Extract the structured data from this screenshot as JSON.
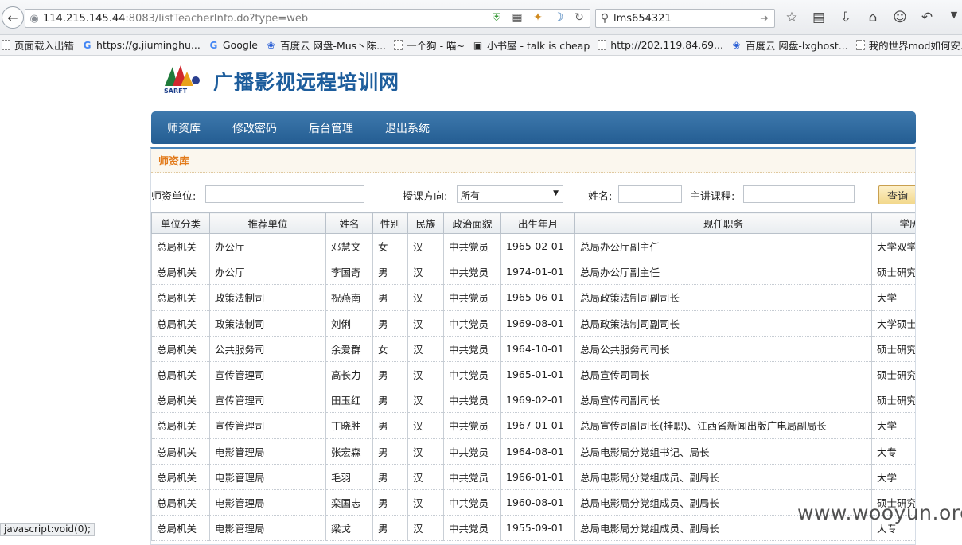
{
  "browser": {
    "url_host": "114.215.145.44",
    "url_rest": ":8083/listTeacherInfo.do?type=web",
    "search_text": "lms654321",
    "bookmarks": [
      {
        "label": "页面载入出错",
        "icon": "page"
      },
      {
        "label": "https://g.jiuminghu...",
        "icon": "google-g"
      },
      {
        "label": "Google",
        "icon": "google-g"
      },
      {
        "label": "百度云 网盘-Mus丶陈...",
        "icon": "baidu-paw"
      },
      {
        "label": "一个狗 - 喵~",
        "icon": "page"
      },
      {
        "label": "小书屋 - talk is cheap",
        "icon": "book"
      },
      {
        "label": "http://202.119.84.69...",
        "icon": "page"
      },
      {
        "label": "百度云 网盘-lxghost...",
        "icon": "baidu-paw"
      },
      {
        "label": "我的世界mod如何安...",
        "icon": "page"
      }
    ]
  },
  "site": {
    "logo_text": "SARFT",
    "title": "广播影视远程培训网",
    "nav": [
      "师资库",
      "修改密码",
      "后台管理",
      "退出系统"
    ]
  },
  "panel": {
    "heading": "师资库",
    "filters": {
      "unit_label": "师资单位:",
      "direction_label": "授课方向:",
      "direction_value": "所有",
      "name_label": "姓名:",
      "course_label": "主讲课程:",
      "query_button": "查询"
    }
  },
  "table": {
    "columns": [
      "单位分类",
      "推荐单位",
      "姓名",
      "性别",
      "民族",
      "政治面貌",
      "出生年月",
      "现任职务",
      "学历"
    ],
    "rows": [
      [
        "总局机关",
        "办公厅",
        "邓慧文",
        "女",
        "汉",
        "中共党员",
        "1965-02-01",
        "总局办公厅副主任",
        "大学双学位"
      ],
      [
        "总局机关",
        "办公厅",
        "李国奇",
        "男",
        "汉",
        "中共党员",
        "1974-01-01",
        "总局办公厅副主任",
        "硕士研究生"
      ],
      [
        "总局机关",
        "政策法制司",
        "祝燕南",
        "男",
        "汉",
        "中共党员",
        "1965-06-01",
        "总局政策法制司副司长",
        "大学"
      ],
      [
        "总局机关",
        "政策法制司",
        "刘俐",
        "男",
        "汉",
        "中共党员",
        "1969-08-01",
        "总局政策法制司副司长",
        "大学硕士"
      ],
      [
        "总局机关",
        "公共服务司",
        "余爱群",
        "女",
        "汉",
        "中共党员",
        "1964-10-01",
        "总局公共服务司司长",
        "硕士研究生"
      ],
      [
        "总局机关",
        "宣传管理司",
        "高长力",
        "男",
        "汉",
        "中共党员",
        "1965-01-01",
        "总局宣传司司长",
        "硕士研究生"
      ],
      [
        "总局机关",
        "宣传管理司",
        "田玉红",
        "男",
        "汉",
        "中共党员",
        "1969-02-01",
        "总局宣传司副司长",
        "硕士研究生"
      ],
      [
        "总局机关",
        "宣传管理司",
        "丁晓胜",
        "男",
        "汉",
        "中共党员",
        "1967-01-01",
        "总局宣传司副司长(挂职)、江西省新闻出版广电局副局长",
        "大学"
      ],
      [
        "总局机关",
        "电影管理局",
        "张宏森",
        "男",
        "汉",
        "中共党员",
        "1964-08-01",
        "总局电影局分党组书记、局长",
        "大专"
      ],
      [
        "总局机关",
        "电影管理局",
        "毛羽",
        "男",
        "汉",
        "中共党员",
        "1966-01-01",
        "总局电影局分党组成员、副局长",
        "大学"
      ],
      [
        "总局机关",
        "电影管理局",
        "栾国志",
        "男",
        "汉",
        "中共党员",
        "1960-08-01",
        "总局电影局分党组成员、副局长",
        "硕士研究生"
      ],
      [
        "总局机关",
        "电影管理局",
        "梁戈",
        "男",
        "汉",
        "中共党员",
        "1955-09-01",
        "总局电影局分党组成员、副局长",
        "大专"
      ]
    ]
  },
  "status": "javascript:void(0);",
  "watermark": "www.wooyun.org"
}
